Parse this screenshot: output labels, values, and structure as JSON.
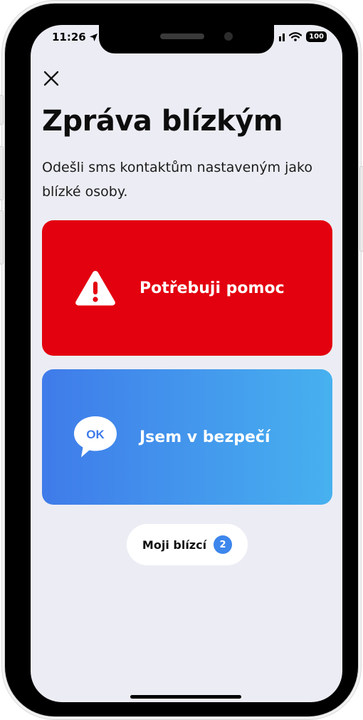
{
  "status_bar": {
    "time": "11:26",
    "battery": "100"
  },
  "header": {
    "title": "Zpráva blízkým",
    "subtitle": "Odešli sms kontaktům nastaveným jako blízké osoby."
  },
  "actions": [
    {
      "label": "Potřebuji pomoc",
      "icon": "warning-triangle-icon",
      "color": "#E3000F"
    },
    {
      "label": "Jsem v bezpečí",
      "icon": "ok-chat-bubble-icon",
      "icon_text": "OK",
      "color_start": "#3F7BEA",
      "color_end": "#47B1EF"
    }
  ],
  "contacts_button": {
    "label": "Moji blízcí",
    "count": "2",
    "badge_color": "#3D86EC"
  },
  "colors": {
    "background": "#ECEDF4",
    "text": "#0D0D0D"
  }
}
